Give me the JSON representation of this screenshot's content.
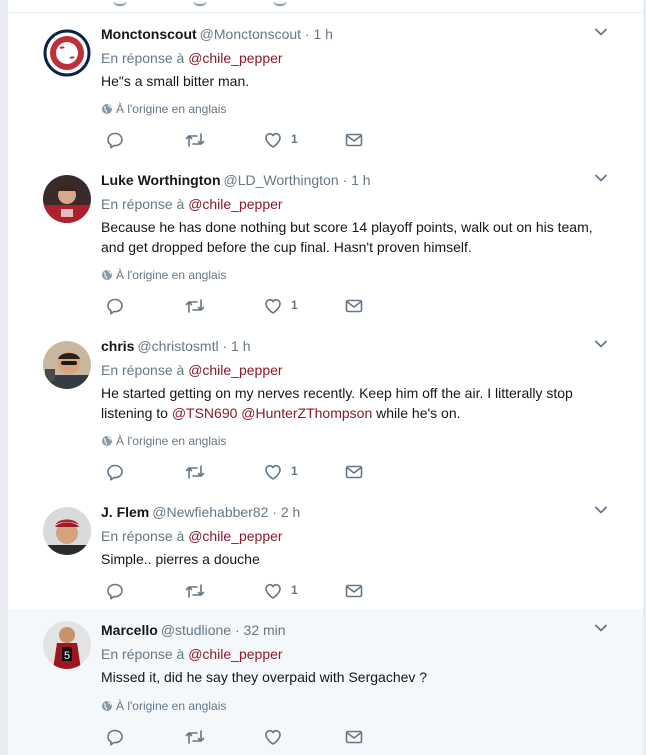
{
  "colors": {
    "mention": "#8b1a2b",
    "muted": "#657786",
    "text": "#14171a",
    "highlight_row": "#f5f8fa"
  },
  "icons": {
    "reply": "reply-icon",
    "retweet": "retweet-icon",
    "like": "heart-icon",
    "dm": "direct-message-icon",
    "menu": "chevron-down-icon",
    "language": "globe-icon"
  },
  "tweets": [
    {
      "fullname": "Monctonscout",
      "handle": "@Monctonscout",
      "dot": "·",
      "time": "1 h",
      "reply_prefix": "En réponse à",
      "reply_to": "@chile_pepper",
      "text_parts": [
        "He\"s a small bitter man."
      ],
      "origin": "À l'origine en anglais",
      "likes": "1"
    },
    {
      "fullname": "Luke Worthington",
      "handle": "@LD_Worthington",
      "dot": "·",
      "time": "1 h",
      "reply_prefix": "En réponse à",
      "reply_to": "@chile_pepper",
      "text_parts": [
        "Because he has done nothing but score 14 playoff points, walk out on his team, and get dropped before the cup final. Hasn't proven himself."
      ],
      "origin": "À l'origine en anglais",
      "likes": "1"
    },
    {
      "fullname": "chris",
      "handle": "@christosmtl",
      "dot": "·",
      "time": "1 h",
      "reply_prefix": "En réponse à",
      "reply_to": "@chile_pepper",
      "text_parts": [
        "He started getting on my nerves recently. Keep him off the air. I litterally stop listening to ",
        "@TSN690",
        " ",
        "@HunterZThompson",
        " while he's on."
      ],
      "origin": "À l'origine en anglais",
      "likes": "1"
    },
    {
      "fullname": "J. Flem",
      "handle": "@Newfiehabber82",
      "dot": "·",
      "time": "2 h",
      "reply_prefix": "En réponse à",
      "reply_to": "@chile_pepper",
      "text_parts": [
        "Simple.. pierres a douche"
      ],
      "likes": "1"
    },
    {
      "fullname": "Marcello",
      "handle": "@studlione",
      "dot": "·",
      "time": "32 min",
      "reply_prefix": "En réponse à",
      "reply_to": "@chile_pepper",
      "text_parts": [
        "Missed it, did he say they overpaid with Sergachev ?"
      ],
      "origin": "À l'origine en anglais"
    }
  ]
}
